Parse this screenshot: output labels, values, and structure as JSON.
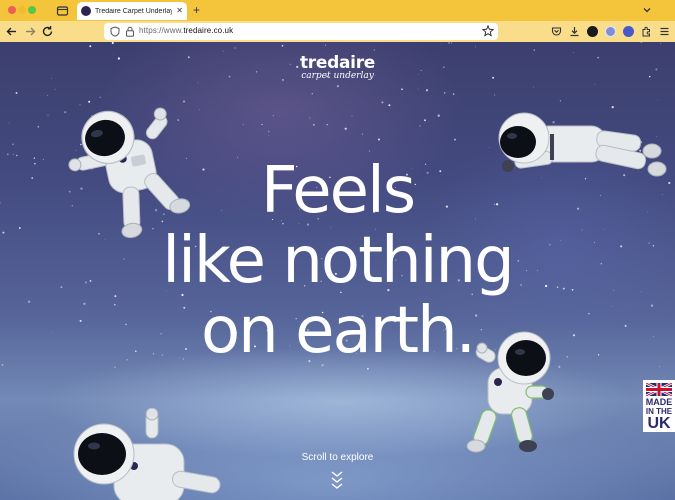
{
  "browser": {
    "tab_title": "Tredaire Carpet Underlay | Mak",
    "tab_close": "✕",
    "new_tab": "+",
    "url_prefix": "https://www.",
    "url_host": "tredaire.co.uk",
    "url_full": "https://www.tredaire.co.uk"
  },
  "page": {
    "brand_name": "tredaire",
    "brand_tagline": "carpet underlay",
    "headline": [
      "Feels",
      "like nothing",
      "on earth."
    ],
    "scroll_label": "Scroll to explore",
    "uk_badge": [
      "MADE",
      "IN THE",
      "UK"
    ]
  },
  "colors": {
    "tab_bar": "#f4c53a",
    "nav_bar": "#f9dd8a",
    "sky_top": "#3c3f6e",
    "sky_bottom": "#7389b6",
    "badge_text": "#2b2a6a"
  },
  "icons": [
    "tab-list-icon",
    "tab-close-icon",
    "new-tab-icon",
    "tab-menu-icon",
    "back-icon",
    "forward-icon",
    "reload-icon",
    "shield-icon",
    "lock-icon",
    "bookmark-star-icon",
    "pocket-icon",
    "downloads-icon",
    "extension-icon",
    "puzzle-icon",
    "menu-icon",
    "scroll-down-icon",
    "union-flag-icon"
  ]
}
